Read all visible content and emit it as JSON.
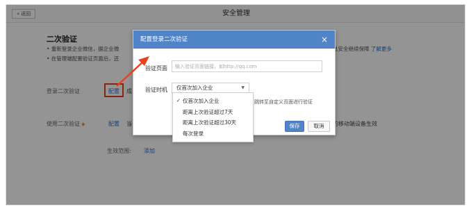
{
  "header": {
    "back_label": "返回",
    "back_icon": "«",
    "title": "安全管理"
  },
  "section": {
    "title": "二次验证",
    "desc1": "• 重新登录企业微信，据企业微",
    "desc2": "• 在管理端配置验证页面后，还",
    "desc_right": "息安全继续保障",
    "learn_more": "了解更多"
  },
  "rows": {
    "login_label": "登录二次验证",
    "login_config": "配置",
    "login_cut": "成",
    "use_label": "使用二次验证",
    "use_config": "配置",
    "use_cut": "当",
    "use_right": "的移动端设备生效",
    "scope_label": "生效范围:",
    "scope_add": "添加"
  },
  "dialog": {
    "title": "配置登录二次验证",
    "close_icon": "×",
    "url_label": "验证页面",
    "url_placeholder": "输入验证页面链接，如http://qq.com",
    "time_label": "验证时机",
    "time_value": "仅首次加入企业",
    "hint": "跳转至自定义页面进行验证",
    "save_label": "保存",
    "cancel_label": "取消"
  },
  "dropdown": {
    "items": [
      {
        "label": "仅首次加入企业",
        "checked": "✓"
      },
      {
        "label": "距离上次验证超过7天",
        "checked": ""
      },
      {
        "label": "距离上次验证超过30天",
        "checked": ""
      },
      {
        "label": "每次登录",
        "checked": ""
      }
    ]
  },
  "colors": {
    "accent": "#4f84c9",
    "link": "#2a6fd6",
    "highlight": "#e8421c"
  }
}
